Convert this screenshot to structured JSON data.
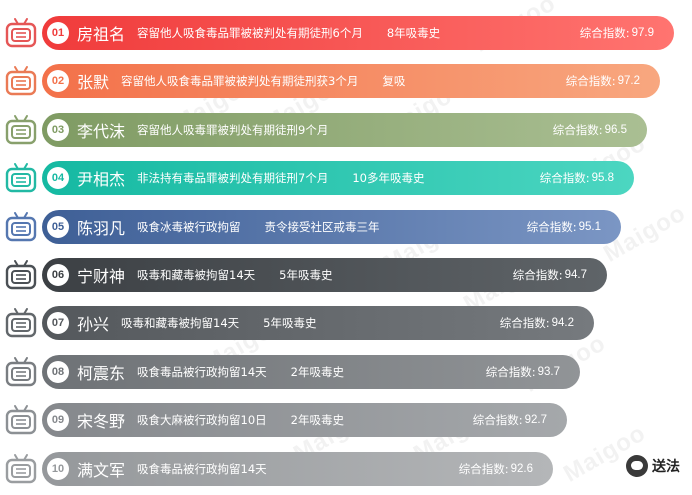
{
  "watermark": "Maigoo",
  "footer": {
    "brand_text": "送法"
  },
  "rows": [
    {
      "rank": "01",
      "name": "房祖名",
      "desc": "容留他人吸食毒品罪被被判处有期徒刑6个月",
      "desc2": "8年吸毒史",
      "score_label": "综合指数:",
      "score": "97.9",
      "c1": "#f03b3b",
      "c2": "#ff7470",
      "icon": "#e55656",
      "width": 632
    },
    {
      "rank": "02",
      "name": "张默",
      "desc": "容留他人吸食毒品罪被被判处有期徒刑获3个月",
      "desc2": "复吸",
      "score_label": "综合指数:",
      "score": "97.2",
      "c1": "#f3714a",
      "c2": "#f8a77f",
      "icon": "#ea7a55",
      "width": 618
    },
    {
      "rank": "03",
      "name": "李代沫",
      "desc": "容留他人吸毒罪被判处有期徒刑9个月",
      "desc2": "",
      "score_label": "综合指数:",
      "score": "96.5",
      "c1": "#7f9b63",
      "c2": "#aabf93",
      "icon": "#88a06c",
      "width": 605
    },
    {
      "rank": "04",
      "name": "尹相杰",
      "desc": "非法持有毒品罪被判处有期徒刑7个月",
      "desc2": "10多年吸毒史",
      "score_label": "综合指数:",
      "score": "95.8",
      "c1": "#15b9a2",
      "c2": "#4cd6c1",
      "icon": "#22b9a4",
      "width": 592
    },
    {
      "rank": "05",
      "name": "陈羽凡",
      "desc": "吸食冰毒被行政拘留",
      "desc2": "责令接受社区戒毒三年",
      "score_label": "综合指数:",
      "score": "95.1",
      "c1": "#3e5f96",
      "c2": "#7b96c4",
      "icon": "#5577b0",
      "width": 579
    },
    {
      "rank": "06",
      "name": "宁财神",
      "desc": "吸毒和藏毒被拘留14天",
      "desc2": "5年吸毒史",
      "score_label": "综合指数:",
      "score": "94.7",
      "c1": "#3c4044",
      "c2": "#5f6468",
      "icon": "#4b5055",
      "width": 565
    },
    {
      "rank": "07",
      "name": "孙兴",
      "desc": "吸毒和藏毒被拘留14天",
      "desc2": "5年吸毒史",
      "score_label": "综合指数:",
      "score": "94.2",
      "c1": "#54585c",
      "c2": "#767a7e",
      "icon": "#62676b",
      "width": 552
    },
    {
      "rank": "08",
      "name": "柯震东",
      "desc": "吸食毒品被行政拘留14天",
      "desc2": "2年吸毒史",
      "score_label": "综合指数:",
      "score": "93.7",
      "c1": "#6e7276",
      "c2": "#919497",
      "icon": "#797d81",
      "width": 538
    },
    {
      "rank": "09",
      "name": "宋冬野",
      "desc": "吸食大麻被行政拘留10日",
      "desc2": "2年吸毒史",
      "score_label": "综合指数:",
      "score": "92.7",
      "c1": "#85888c",
      "c2": "#a5a8ab",
      "icon": "#8c9094",
      "width": 525
    },
    {
      "rank": "10",
      "name": "满文军",
      "desc": "吸食毒品被行政拘留14天",
      "desc2": "",
      "score_label": "综合指数:",
      "score": "92.6",
      "c1": "#95989b",
      "c2": "#b4b6b8",
      "icon": "#9a9da0",
      "width": 511
    }
  ]
}
